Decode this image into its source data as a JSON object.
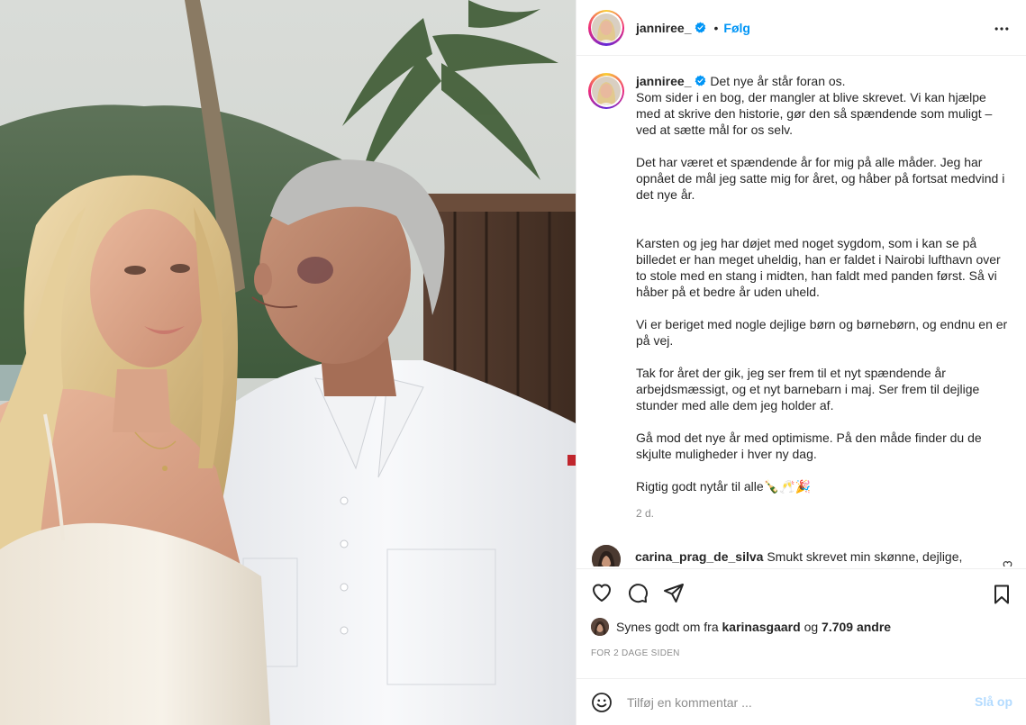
{
  "post": {
    "username": "janniree_",
    "follow_label": "Følg",
    "dot": "•"
  },
  "caption": {
    "username": "janniree_",
    "paragraphs": [
      "Det nye år står foran os.",
      "Som sider i en bog, der mangler at blive skrevet. Vi kan hjælpe med at skrive den historie, gør den så spændende som muligt – ved at sætte mål for os selv.",
      "Det har været et spændende år for mig på alle måder. Jeg har opnået de mål jeg satte mig for året, og håber på fortsat medvind i det nye år.",
      "Karsten og jeg har døjet med noget sygdom, som i kan se på billedet er han meget uheldig, han er faldet i Nairobi lufthavn over to stole med en stang i midten, han faldt med panden først. Så vi håber på et bedre år uden uheld.",
      "Vi er beriget med nogle dejlige børn og børnebørn, og endnu en er på vej.",
      "Tak for året der gik, jeg ser frem til et nyt spændende år arbejdsmæssigt, og et nyt barnebarn i maj. Ser frem til dejlige stunder med alle dem jeg holder af.",
      "Gå mod det nye år med optimisme. På den måde finder du de skjulte muligheder i hver ny dag.",
      "Rigtig godt nytår til alle🍾🥂🎉"
    ],
    "time": "2 d."
  },
  "comment": {
    "username": "carina_prag_de_silva",
    "text": "Smukt skrevet min skønne, dejlige,"
  },
  "likes": {
    "prefix": "Synes godt om fra",
    "user": "karinasgaard",
    "middle": "og",
    "count": "7.709 andre"
  },
  "date_label": "FOR 2 DAGE SIDEN",
  "add_comment": {
    "placeholder": "Tilføj en kommentar ...",
    "post_label": "Slå op"
  },
  "colors": {
    "accent": "#0095f6",
    "post_disabled": "#b3dbff",
    "text": "#262626",
    "muted": "#8e8e8e"
  }
}
